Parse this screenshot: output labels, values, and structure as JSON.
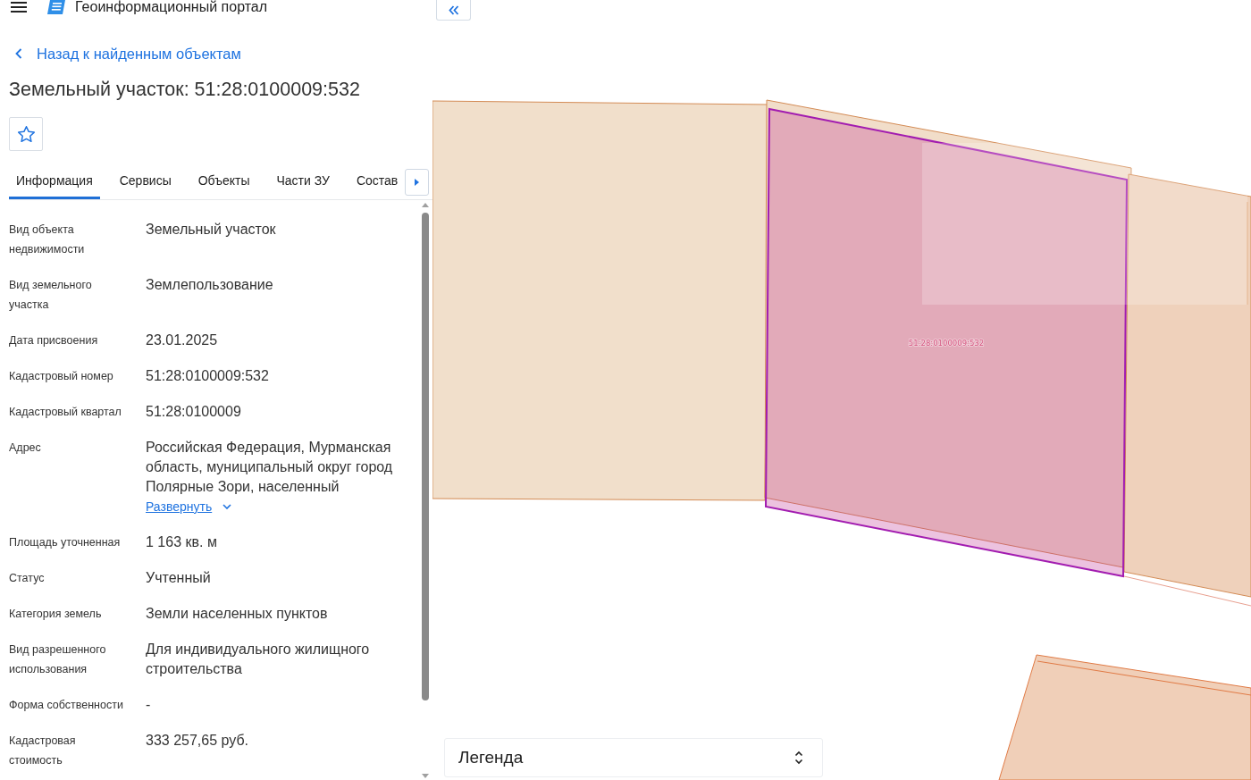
{
  "header": {
    "title": "Геоинформационный портал"
  },
  "back_link": "Назад к найденным объектам",
  "object_title": "Земельный участок: 51:28:0100009:532",
  "favorite": {
    "on": false
  },
  "tabs": [
    {
      "label": "Информация",
      "selected": true
    },
    {
      "label": "Сервисы",
      "selected": false
    },
    {
      "label": "Объекты",
      "selected": false
    },
    {
      "label": "Части ЗУ",
      "selected": false
    },
    {
      "label": "Состав",
      "selected": false
    }
  ],
  "details": [
    {
      "label": "Вид объекта недвижимости",
      "value": "Земельный участок"
    },
    {
      "label": "Вид земельного участка",
      "value": "Землепользование"
    },
    {
      "label": "Дата присвоения",
      "value": "23.01.2025"
    },
    {
      "label": "Кадастровый номер",
      "value": "51:28:0100009:532"
    },
    {
      "label": "Кадастровый квартал",
      "value": "51:28:0100009"
    },
    {
      "label": "Адрес",
      "value": "Российская Федерация, Мурманская область, муниципальный округ город Полярные Зори, населенный",
      "expand_link": "Развернуть"
    },
    {
      "label": "Площадь уточненная",
      "value": "1 163 кв. м"
    },
    {
      "label": "Статус",
      "value": "Учтенный"
    },
    {
      "label": "Категория земель",
      "value": "Земли населенных пунктов"
    },
    {
      "label": "Вид разрешенного использования",
      "value": "Для индивидуального жилищного строительства"
    },
    {
      "label": "Форма собственности",
      "value": "-"
    },
    {
      "label": "Кадастровая стоимость",
      "value": "333 257,65 руб."
    }
  ],
  "map": {
    "parcel_label": "51:28:0100009:532"
  },
  "legend": {
    "title": "Легенда"
  }
}
